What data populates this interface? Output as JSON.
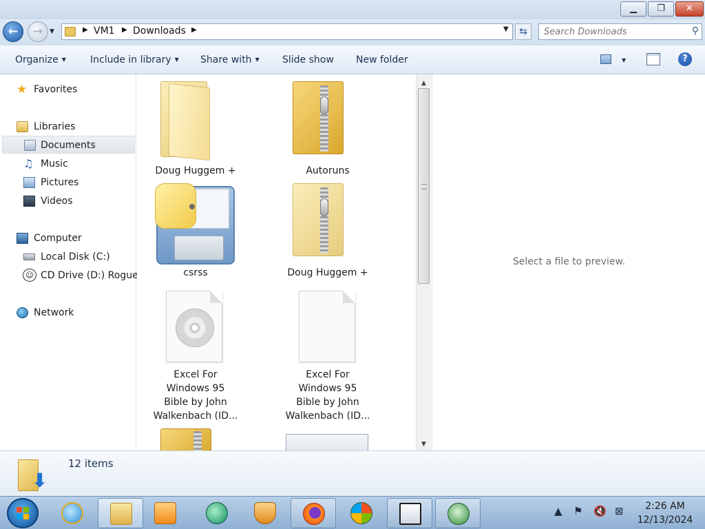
{
  "window": {
    "buttons": {
      "minimize": "▁",
      "maximize": "❐",
      "close": "✕"
    }
  },
  "nav": {
    "back_icon": "back-arrow-icon",
    "forward_icon": "forward-arrow-icon",
    "breadcrumb": [
      "VM1",
      "Downloads"
    ],
    "search_placeholder": "Search Downloads"
  },
  "toolbar": {
    "organize": "Organize",
    "include_in_library": "Include in library",
    "share_with": "Share with",
    "slide_show": "Slide show",
    "new_folder": "New folder",
    "help": "?"
  },
  "sidebar": {
    "favorites": "Favorites",
    "libraries": "Libraries",
    "library_items": [
      "Documents",
      "Music",
      "Pictures",
      "Videos"
    ],
    "computer": "Computer",
    "computer_items": [
      "Local Disk (C:)",
      "CD Drive (D:) Rogue"
    ],
    "network": "Network",
    "selected": "Documents"
  },
  "files": [
    {
      "name": "Doug Huggem +",
      "type": "folder"
    },
    {
      "name": "Autoruns",
      "type": "zip-folder"
    },
    {
      "name": "csrss",
      "type": "python-file"
    },
    {
      "name": "Doug Huggem +",
      "type": "zip-folder"
    },
    {
      "name": "Excel For Windows 95 Bible by John Walkenbach (ID...",
      "lines": [
        "Excel For",
        "Windows 95",
        "Bible by John",
        "Walkenbach (ID..."
      ],
      "type": "disc-image"
    },
    {
      "name": "Excel For Windows 95 Bible by John Walkenbach (ID...",
      "lines": [
        "Excel For",
        "Windows 95",
        "Bible by John",
        "Walkenbach (ID..."
      ],
      "type": "blank-file"
    }
  ],
  "preview": {
    "message": "Select a file to preview."
  },
  "details": {
    "item_count": "12 items"
  },
  "taskbar": {
    "time": "2:26 AM",
    "date": "12/13/2024"
  }
}
